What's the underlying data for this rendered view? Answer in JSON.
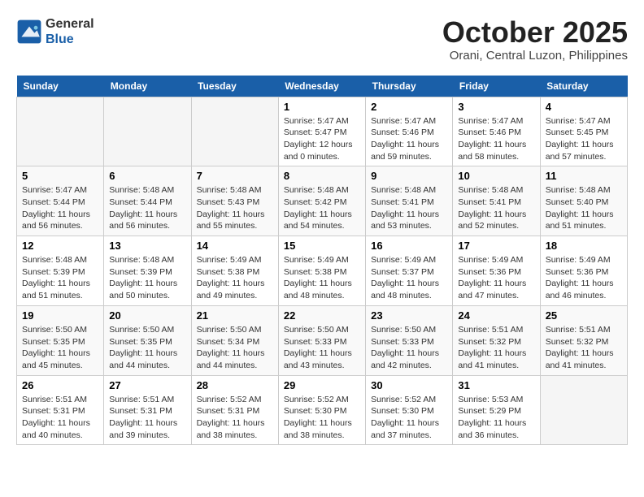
{
  "header": {
    "logo_line1": "General",
    "logo_line2": "Blue",
    "month": "October 2025",
    "location": "Orani, Central Luzon, Philippines"
  },
  "weekdays": [
    "Sunday",
    "Monday",
    "Tuesday",
    "Wednesday",
    "Thursday",
    "Friday",
    "Saturday"
  ],
  "weeks": [
    [
      {
        "day": "",
        "info": ""
      },
      {
        "day": "",
        "info": ""
      },
      {
        "day": "",
        "info": ""
      },
      {
        "day": "1",
        "info": "Sunrise: 5:47 AM\nSunset: 5:47 PM\nDaylight: 12 hours\nand 0 minutes."
      },
      {
        "day": "2",
        "info": "Sunrise: 5:47 AM\nSunset: 5:46 PM\nDaylight: 11 hours\nand 59 minutes."
      },
      {
        "day": "3",
        "info": "Sunrise: 5:47 AM\nSunset: 5:46 PM\nDaylight: 11 hours\nand 58 minutes."
      },
      {
        "day": "4",
        "info": "Sunrise: 5:47 AM\nSunset: 5:45 PM\nDaylight: 11 hours\nand 57 minutes."
      }
    ],
    [
      {
        "day": "5",
        "info": "Sunrise: 5:47 AM\nSunset: 5:44 PM\nDaylight: 11 hours\nand 56 minutes."
      },
      {
        "day": "6",
        "info": "Sunrise: 5:48 AM\nSunset: 5:44 PM\nDaylight: 11 hours\nand 56 minutes."
      },
      {
        "day": "7",
        "info": "Sunrise: 5:48 AM\nSunset: 5:43 PM\nDaylight: 11 hours\nand 55 minutes."
      },
      {
        "day": "8",
        "info": "Sunrise: 5:48 AM\nSunset: 5:42 PM\nDaylight: 11 hours\nand 54 minutes."
      },
      {
        "day": "9",
        "info": "Sunrise: 5:48 AM\nSunset: 5:41 PM\nDaylight: 11 hours\nand 53 minutes."
      },
      {
        "day": "10",
        "info": "Sunrise: 5:48 AM\nSunset: 5:41 PM\nDaylight: 11 hours\nand 52 minutes."
      },
      {
        "day": "11",
        "info": "Sunrise: 5:48 AM\nSunset: 5:40 PM\nDaylight: 11 hours\nand 51 minutes."
      }
    ],
    [
      {
        "day": "12",
        "info": "Sunrise: 5:48 AM\nSunset: 5:39 PM\nDaylight: 11 hours\nand 51 minutes."
      },
      {
        "day": "13",
        "info": "Sunrise: 5:48 AM\nSunset: 5:39 PM\nDaylight: 11 hours\nand 50 minutes."
      },
      {
        "day": "14",
        "info": "Sunrise: 5:49 AM\nSunset: 5:38 PM\nDaylight: 11 hours\nand 49 minutes."
      },
      {
        "day": "15",
        "info": "Sunrise: 5:49 AM\nSunset: 5:38 PM\nDaylight: 11 hours\nand 48 minutes."
      },
      {
        "day": "16",
        "info": "Sunrise: 5:49 AM\nSunset: 5:37 PM\nDaylight: 11 hours\nand 48 minutes."
      },
      {
        "day": "17",
        "info": "Sunrise: 5:49 AM\nSunset: 5:36 PM\nDaylight: 11 hours\nand 47 minutes."
      },
      {
        "day": "18",
        "info": "Sunrise: 5:49 AM\nSunset: 5:36 PM\nDaylight: 11 hours\nand 46 minutes."
      }
    ],
    [
      {
        "day": "19",
        "info": "Sunrise: 5:50 AM\nSunset: 5:35 PM\nDaylight: 11 hours\nand 45 minutes."
      },
      {
        "day": "20",
        "info": "Sunrise: 5:50 AM\nSunset: 5:35 PM\nDaylight: 11 hours\nand 44 minutes."
      },
      {
        "day": "21",
        "info": "Sunrise: 5:50 AM\nSunset: 5:34 PM\nDaylight: 11 hours\nand 44 minutes."
      },
      {
        "day": "22",
        "info": "Sunrise: 5:50 AM\nSunset: 5:33 PM\nDaylight: 11 hours\nand 43 minutes."
      },
      {
        "day": "23",
        "info": "Sunrise: 5:50 AM\nSunset: 5:33 PM\nDaylight: 11 hours\nand 42 minutes."
      },
      {
        "day": "24",
        "info": "Sunrise: 5:51 AM\nSunset: 5:32 PM\nDaylight: 11 hours\nand 41 minutes."
      },
      {
        "day": "25",
        "info": "Sunrise: 5:51 AM\nSunset: 5:32 PM\nDaylight: 11 hours\nand 41 minutes."
      }
    ],
    [
      {
        "day": "26",
        "info": "Sunrise: 5:51 AM\nSunset: 5:31 PM\nDaylight: 11 hours\nand 40 minutes."
      },
      {
        "day": "27",
        "info": "Sunrise: 5:51 AM\nSunset: 5:31 PM\nDaylight: 11 hours\nand 39 minutes."
      },
      {
        "day": "28",
        "info": "Sunrise: 5:52 AM\nSunset: 5:31 PM\nDaylight: 11 hours\nand 38 minutes."
      },
      {
        "day": "29",
        "info": "Sunrise: 5:52 AM\nSunset: 5:30 PM\nDaylight: 11 hours\nand 38 minutes."
      },
      {
        "day": "30",
        "info": "Sunrise: 5:52 AM\nSunset: 5:30 PM\nDaylight: 11 hours\nand 37 minutes."
      },
      {
        "day": "31",
        "info": "Sunrise: 5:53 AM\nSunset: 5:29 PM\nDaylight: 11 hours\nand 36 minutes."
      },
      {
        "day": "",
        "info": ""
      }
    ]
  ]
}
